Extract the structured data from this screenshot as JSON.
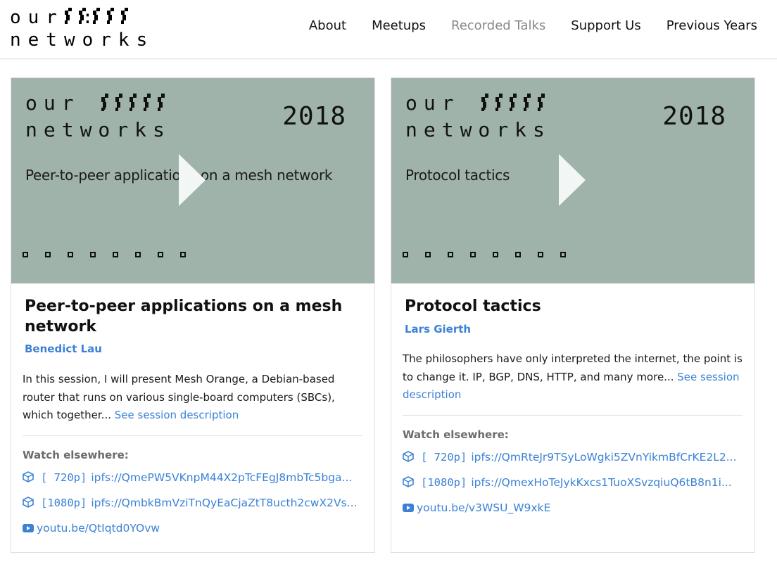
{
  "site": {
    "logo_line1": "our :",
    "logo_line2": "networks"
  },
  "nav": [
    {
      "label": "About"
    },
    {
      "label": "Meetups"
    },
    {
      "label": "Recorded Talks",
      "active": true
    },
    {
      "label": "Support Us"
    },
    {
      "label": "Previous Years"
    }
  ],
  "talks": [
    {
      "thumb": {
        "logo_line1": "our :",
        "logo_line2": "networks",
        "year": "2018",
        "title": "Peer-to-peer applications on a mesh network"
      },
      "title": "Peer-to-peer applications on a mesh network",
      "speaker": "Benedict Lau",
      "description": "In this session, I will present Mesh Orange, a Debian-based router that runs on various single-board computers (SBCs), which together...",
      "more_label": "See session description",
      "watch_label": "Watch elsewhere:",
      "links": [
        {
          "icon": "cube-icon",
          "res": "[ 720p]",
          "url": "ipfs://QmePW5VKnpM44X2pTcFEgJ8mbTc5bga..."
        },
        {
          "icon": "cube-icon",
          "res": "[1080p]",
          "url": "ipfs://QmbkBmVziTnQyEaCjaZtT8ucth2cwX2Vs..."
        },
        {
          "icon": "youtube-icon",
          "url": "youtu.be/QtIqtd0YOvw"
        }
      ]
    },
    {
      "thumb": {
        "logo_line1": "our :",
        "logo_line2": "networks",
        "year": "2018",
        "title": "Protocol tactics"
      },
      "title": "Protocol tactics",
      "speaker": "Lars Gierth",
      "description": "The philosophers have only interpreted the internet, the point is to change it. IP, BGP, DNS, HTTP, and many more...",
      "more_label": "See session description",
      "watch_label": "Watch elsewhere:",
      "links": [
        {
          "icon": "cube-icon",
          "res": "[ 720p]",
          "url": "ipfs://QmRteJr9TSyLoWgki5ZVnYikmBfCrKE2L2..."
        },
        {
          "icon": "cube-icon",
          "res": "[1080p]",
          "url": "ipfs://QmexHoTeJykKxcs1TuoXSvzqiuQ6tB8n1i..."
        },
        {
          "icon": "youtube-icon",
          "url": "youtu.be/v3WSU_W9xkE"
        }
      ]
    }
  ],
  "colors": {
    "accent": "#3b82d6",
    "thumb_bg": "#9fb3ab",
    "nav_active": "#888888"
  }
}
